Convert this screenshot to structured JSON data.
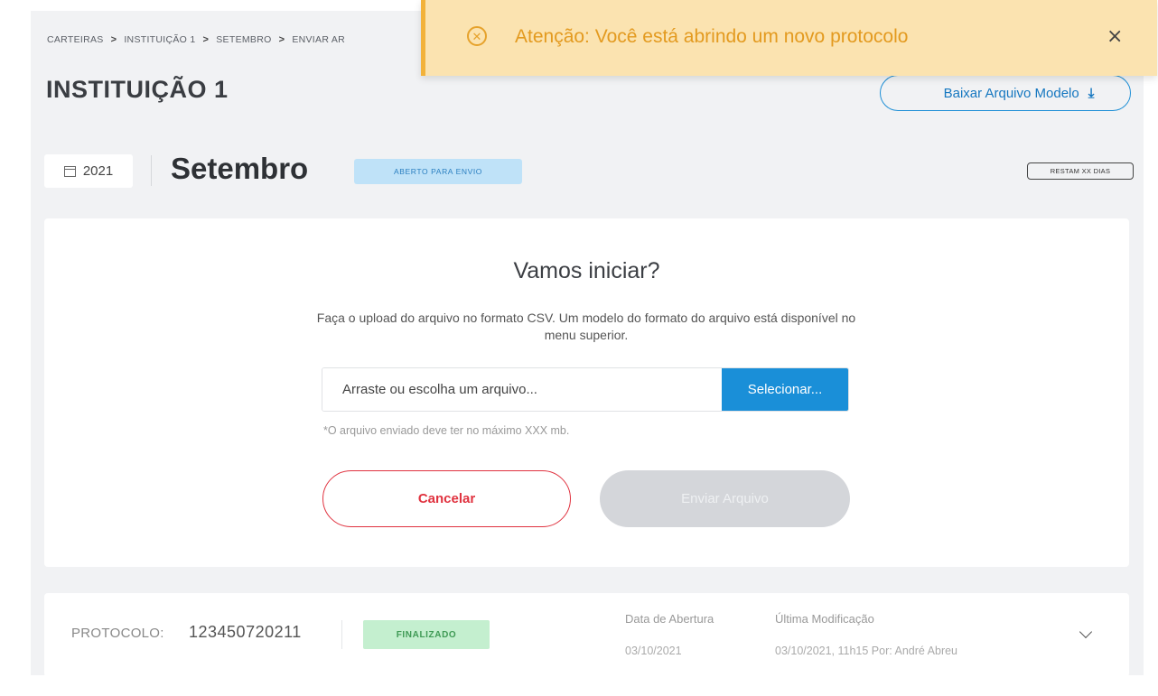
{
  "breadcrumb": [
    "CARTEIRAS",
    "INSTITUIÇÃO 1",
    "SETEMBRO",
    "ENVIAR AR"
  ],
  "breadcrumb_separator": ">",
  "page_title": "INSTITUIÇÃO 1",
  "download_button": {
    "label": "Baixar Arquivo Modelo",
    "icon": "download-icon"
  },
  "period": {
    "year": "2021",
    "month": "Setembro",
    "status": "ABERTO PARA ENVIO",
    "days_left": "RESTAM XX DIAS"
  },
  "upload": {
    "heading": "Vamos iniciar?",
    "description": "Faça o upload do arquivo no formato CSV. Um modelo do formato do arquivo está disponível no menu superior.",
    "placeholder": "Arraste ou escolha um arquivo...",
    "select_label": "Selecionar...",
    "note": "*O arquivo enviado deve ter no máximo XXX mb.",
    "cancel_label": "Cancelar",
    "send_label": "Enviar Arquivo"
  },
  "protocol": {
    "label": "PROTOCOLO:",
    "number": "123450720211",
    "status": "FINALIZADO",
    "opened_header": "Data de Abertura",
    "opened_value": "03/10/2021",
    "modified_header": "Última Modificação",
    "modified_value": "03/10/2021, 11h15 Por: André Abreu"
  },
  "toast": {
    "message": "Atenção: Você está abrindo um novo protocolo",
    "icon": "error-circle-icon",
    "close": "×"
  },
  "colors": {
    "primary": "#1a8fd8",
    "danger": "#e0323f",
    "warning_bg": "#fbe3b0",
    "warning_text": "#e39a1f",
    "success_bg": "#c4efcf"
  }
}
